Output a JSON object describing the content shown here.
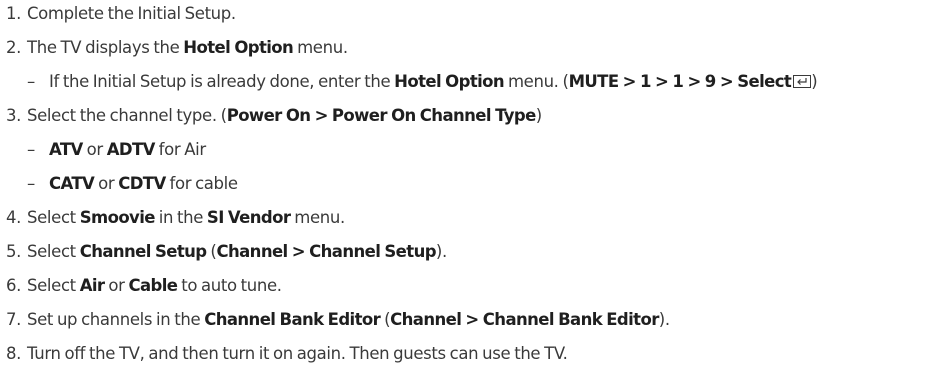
{
  "steps": [
    {
      "number": "1.",
      "parts": [
        "Complete the Initial Setup."
      ]
    },
    {
      "number": "2.",
      "parts": [
        "The TV displays the ",
        "Hotel Option",
        " menu."
      ]
    },
    {
      "sub": true,
      "dash": "–",
      "parts": [
        "If the Initial Setup is already done, enter the ",
        "Hotel Option",
        " menu. (",
        "MUTE > 1 > 1 > 9 > Select",
        "",
        ")"
      ]
    },
    {
      "number": "3.",
      "parts": [
        "Select the channel type. (",
        "Power On > Power On Channel Type",
        ")"
      ]
    },
    {
      "sub": true,
      "dash": "–",
      "parts": [
        "ATV",
        " or ",
        "ADTV",
        " for Air"
      ]
    },
    {
      "sub": true,
      "dash": "–",
      "parts": [
        "CATV",
        " or ",
        "CDTV",
        " for cable"
      ]
    },
    {
      "number": "4.",
      "parts": [
        "Select ",
        "Smoovie",
        " in the ",
        "SI Vendor",
        " menu."
      ]
    },
    {
      "number": "5.",
      "parts": [
        "Select ",
        "Channel Setup",
        " (",
        "Channel > Channel Setup",
        ")."
      ]
    },
    {
      "number": "6.",
      "parts": [
        "Select ",
        "Air",
        " or ",
        "Cable",
        " to auto tune."
      ]
    },
    {
      "number": "7.",
      "parts": [
        "Set up channels in the ",
        "Channel Bank Editor",
        " (",
        "Channel > Channel Bank Editor",
        ")."
      ]
    },
    {
      "number": "8.",
      "parts": [
        "Turn off the TV, and then turn it on again. Then guests can use the TV."
      ]
    }
  ],
  "icons": {
    "enter": "enter-key-icon"
  }
}
